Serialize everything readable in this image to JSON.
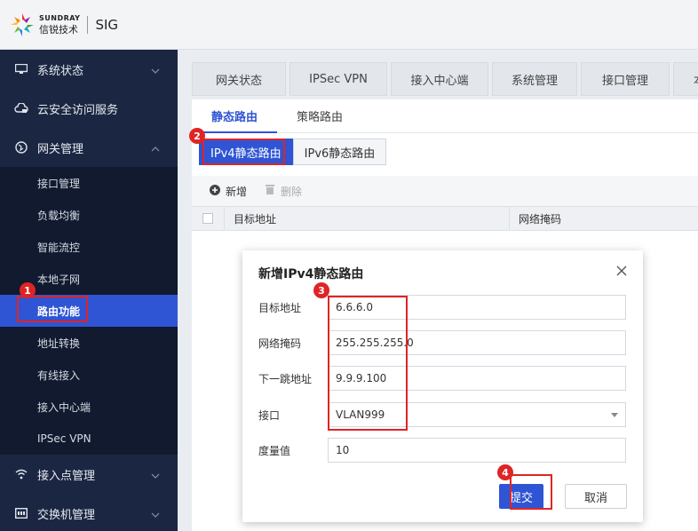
{
  "header": {
    "logo_en": "SUNDRAY",
    "logo_cn": "信锐技术",
    "app_name": "SIG"
  },
  "sidebar": {
    "groups": [
      {
        "label": "系统状态",
        "icon": "monitor-icon",
        "chevron": "down"
      },
      {
        "label": "云安全访问服务",
        "icon": "cloud-lock-icon"
      },
      {
        "label": "网关管理",
        "icon": "globe-icon",
        "chevron": "up"
      }
    ],
    "sub_items": [
      "接口管理",
      "负载均衡",
      "智能流控",
      "本地子网",
      "路由功能",
      "地址转换",
      "有线接入",
      "接入中心端",
      "IPSec VPN"
    ],
    "active_sub_index": 4,
    "bottom_groups": [
      {
        "label": "接入点管理",
        "icon": "wifi-icon",
        "chevron": "down"
      },
      {
        "label": "交换机管理",
        "icon": "switch-icon",
        "chevron": "down"
      }
    ]
  },
  "main": {
    "tabs": [
      "网关状态",
      "IPSec VPN",
      "接入中心端",
      "系统管理",
      "接口管理",
      "本"
    ],
    "subtabs": [
      "静态路由",
      "策略路由"
    ],
    "active_subtab": 0,
    "segments": [
      "IPv4静态路由",
      "IPv6静态路由"
    ],
    "active_segment": 0,
    "toolbar": {
      "add_label": "新增",
      "delete_label": "删除"
    },
    "table_columns": [
      "目标地址",
      "网络掩码"
    ]
  },
  "modal": {
    "title": "新增IPv4静态路由",
    "fields": [
      {
        "label": "目标地址",
        "value": "6.6.6.0"
      },
      {
        "label": "网络掩码",
        "value": "255.255.255.0"
      },
      {
        "label": "下一跳地址",
        "value": "9.9.9.100"
      },
      {
        "label": "接口",
        "value": "VLAN999",
        "type": "select"
      },
      {
        "label": "度量值",
        "value": "10"
      }
    ],
    "submit_label": "提交",
    "cancel_label": "取消"
  },
  "annotations": {
    "markers": [
      "1",
      "2",
      "3",
      "4"
    ],
    "color": "#e02424"
  },
  "colors": {
    "accent": "#2f54d4",
    "sidebar_bg": "#1b2742"
  }
}
